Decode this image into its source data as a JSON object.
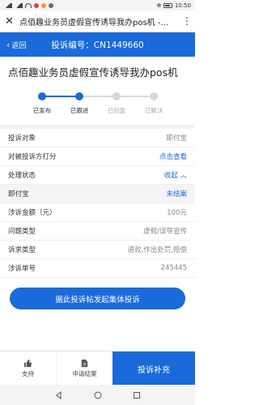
{
  "status": {
    "time": "10:50"
  },
  "title": {
    "text": "点佰趣业务员虚假宣传诱导我办pos机 -..."
  },
  "header": {
    "back_label": "返回",
    "complaint_code": "投诉编号：CN1449660"
  },
  "headline": "点佰趣业务员虚假宣传诱导我办pos机",
  "progress": {
    "steps": [
      {
        "label": "已发布",
        "done": true
      },
      {
        "label": "已跟进",
        "done": true
      },
      {
        "label": "已回复",
        "done": false
      },
      {
        "label": "已解决",
        "done": false
      }
    ],
    "colors": {
      "done": "#1a6ad9",
      "pending": "#d8d8d8"
    }
  },
  "details": {
    "target": {
      "label": "投诉对象",
      "value": "即付宝"
    },
    "rate": {
      "label": "对被投诉方打分",
      "value": "点击查看"
    },
    "handle": {
      "label": "处理状态",
      "value": "收起 ︿"
    },
    "company": {
      "label": "即付宝",
      "value": "未结案"
    },
    "amount": {
      "label": "涉诉金额（元）",
      "value": "100元"
    },
    "issue": {
      "label": "问题类型",
      "value": "虚假/误导宣传"
    },
    "claim": {
      "label": "诉求类型",
      "value": "退款,作出处罚,赔偿"
    },
    "number": {
      "label": "涉诉单号",
      "value": "245445"
    }
  },
  "collective_button": "据此投诉帖发起集体投诉",
  "bottom": {
    "support": "支持",
    "apply_close": "申请结案",
    "supplement": "投诉补充"
  }
}
